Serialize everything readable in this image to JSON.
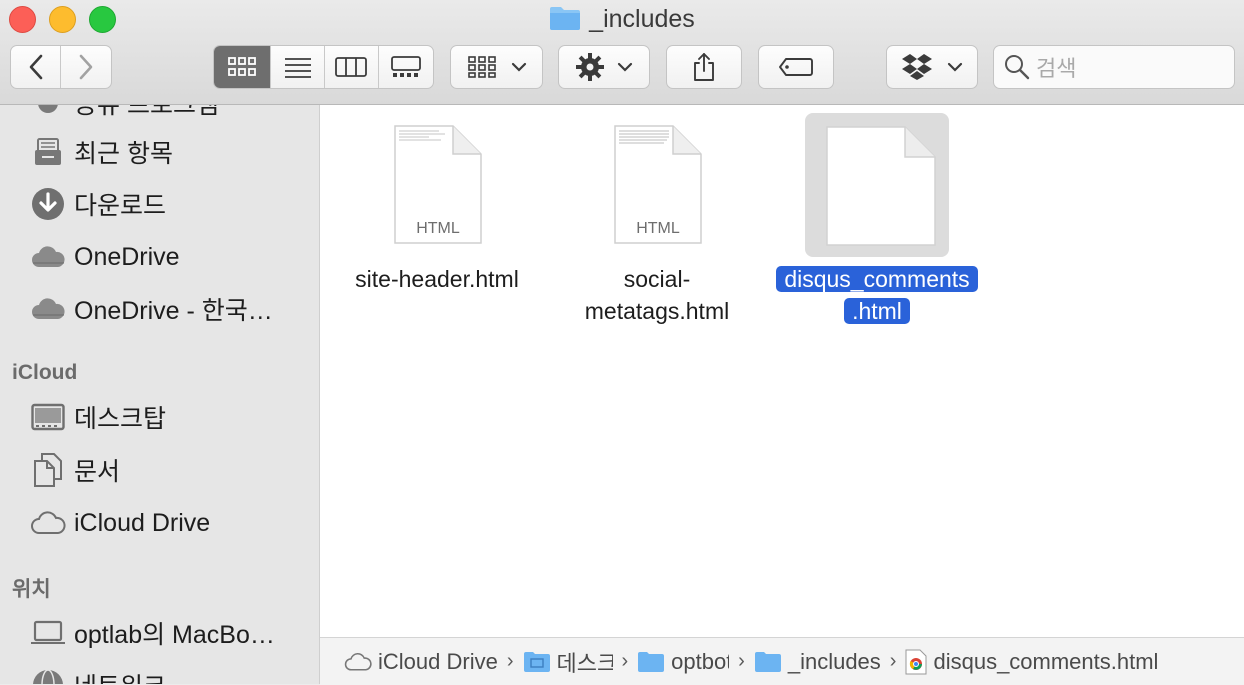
{
  "window": {
    "title": "_includes"
  },
  "toolbar": {
    "search_placeholder": "검색",
    "back_icon": "chevron-left-icon",
    "forward_icon": "chevron-right-icon",
    "view_modes": [
      "icon-view",
      "list-view",
      "column-view",
      "gallery-view"
    ],
    "active_view": "icon-view"
  },
  "sidebar": {
    "partial_top": "공유 프로그램",
    "favorites": [
      {
        "label": "최근 항목",
        "icon": "recents-icon"
      },
      {
        "label": "다운로드",
        "icon": "download-icon"
      },
      {
        "label": "OneDrive",
        "icon": "cloud-icon"
      },
      {
        "label": "OneDrive - 한국…",
        "icon": "cloud-icon"
      }
    ],
    "icloud_heading": "iCloud",
    "icloud": [
      {
        "label": "데스크탑",
        "icon": "desktop-icon"
      },
      {
        "label": "문서",
        "icon": "documents-icon"
      },
      {
        "label": "iCloud Drive",
        "icon": "cloud-outline-icon"
      }
    ],
    "locations_heading": "위치",
    "locations": [
      {
        "label": "optlab의 MacBo…",
        "icon": "laptop-icon"
      },
      {
        "label": "네트워크",
        "icon": "network-icon"
      }
    ]
  },
  "files": [
    {
      "name": "site-header.html",
      "icon_label": "HTML",
      "selected": false
    },
    {
      "name_line1": "social-",
      "name_line2": "metatags.html",
      "icon_label": "HTML",
      "selected": false
    },
    {
      "name_line1": "disqus_comments",
      "name_line2": ".html",
      "selected": true
    }
  ],
  "pathbar": {
    "crumbs": [
      "iCloud Drive",
      "데스크탑",
      "optbot",
      "_includes",
      "disqus_comments.html"
    ]
  },
  "colors": {
    "selection": "#2a62d9",
    "folder": "#6cb4f2"
  }
}
